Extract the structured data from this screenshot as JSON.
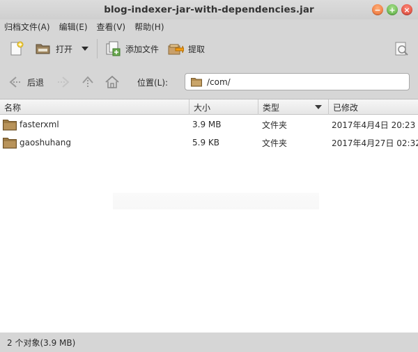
{
  "window": {
    "title": "blog-indexer-jar-with-dependencies.jar",
    "buttons": [
      "minimize-icon",
      "maximize-icon",
      "close-icon"
    ]
  },
  "menu": {
    "archive": "归档文件(A)",
    "edit": "编辑(E)",
    "view": "查看(V)",
    "help": "帮助(H)"
  },
  "toolbar": {
    "new_icon": "new-archive-icon",
    "open_label": "打开",
    "open_icon": "open-folder-icon",
    "add_label": "添加文件",
    "add_icon": "add-files-icon",
    "extract_label": "提取",
    "extract_icon": "extract-icon",
    "properties_icon": "properties-icon"
  },
  "location": {
    "back_label": "后退",
    "label": "位置(L):",
    "path": "/com/"
  },
  "columns": {
    "name": "名称",
    "size": "大小",
    "type": "类型",
    "modified": "已修改"
  },
  "files": [
    {
      "name": "fasterxml",
      "size": "3.9 MB",
      "type": "文件夹",
      "modified": "2017年4月4日 20:23"
    },
    {
      "name": "gaoshuhang",
      "size": "5.9 KB",
      "type": "文件夹",
      "modified": "2017年4月27日 02:32"
    }
  ],
  "status": {
    "text": "2 个对象(3.9 MB)"
  },
  "colors": {
    "folder": "#b08a4e",
    "background": "#d6d6d6",
    "list_background": "#ffffff"
  }
}
